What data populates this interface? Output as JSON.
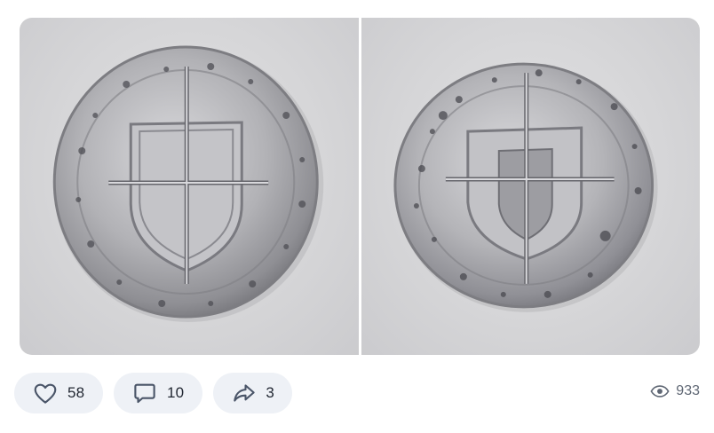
{
  "post": {
    "images": [
      {
        "alt": "coin-obverse",
        "description_icon": "coin-image"
      },
      {
        "alt": "coin-reverse",
        "description_icon": "coin-image"
      }
    ]
  },
  "actions": {
    "like": {
      "icon": "heart-icon",
      "count": "58"
    },
    "comment": {
      "icon": "comment-icon",
      "count": "10"
    },
    "share": {
      "icon": "share-icon",
      "count": "3"
    }
  },
  "views": {
    "icon": "eye-icon",
    "count": "933"
  },
  "colors": {
    "pill_bg": "#eef1f6",
    "icon": "#4a5568",
    "text": "#222833",
    "muted": "#5f6774"
  }
}
